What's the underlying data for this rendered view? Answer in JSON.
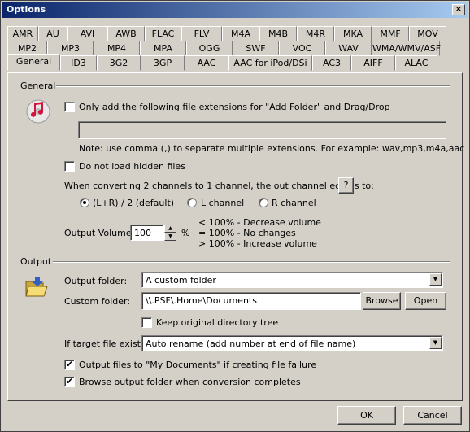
{
  "window": {
    "title": "Options",
    "close_glyph": "×"
  },
  "tabs_row1": [
    "AMR",
    "AU",
    "AVI",
    "AWB",
    "FLAC",
    "FLV",
    "M4A",
    "M4B",
    "M4R",
    "MKA",
    "MMF",
    "MOV"
  ],
  "tabs_row2": [
    "MP2",
    "MP3",
    "MP4",
    "MPA",
    "OGG",
    "SWF",
    "VOC",
    "WAV",
    "WMA/WMV/ASF"
  ],
  "tabs_row3": [
    "General",
    "ID3",
    "3G2",
    "3GP",
    "AAC",
    "AAC for iPod/DSi",
    "AC3",
    "AIFF",
    "ALAC"
  ],
  "active_tab": "General",
  "general": {
    "section_label": "General",
    "only_add_ext_label": "Only add the following file extensions for \"Add Folder\" and Drag/Drop",
    "only_add_ext_checked": false,
    "extensions_value": "",
    "note": "Note: use comma (,) to separate multiple extensions. For example: wav,mp3,m4a,aac",
    "no_hidden_label": "Do not load hidden files",
    "no_hidden_checked": false,
    "channel_prompt": "When converting 2 channels to 1 channel, the out channel equals to:",
    "help_label": "?",
    "radio_lr": "(L+R) / 2 (default)",
    "radio_l": "L channel",
    "radio_r": "R channel",
    "selected_channel": "lr",
    "volume_label": "Output Volume:",
    "volume_value": "100",
    "volume_unit": "%",
    "volume_notes": [
      "< 100% - Decrease volume",
      "= 100% - No changes",
      "> 100% - Increase volume"
    ]
  },
  "output": {
    "section_label": "Output",
    "folder_label": "Output folder:",
    "folder_value": "A custom folder",
    "custom_label": "Custom folder:",
    "custom_value": "\\\\.PSF\\.Home\\Documents",
    "browse_label": "Browse",
    "open_label": "Open",
    "keep_tree_label": "Keep original directory tree",
    "keep_tree_checked": false,
    "exists_label": "If target file exists",
    "exists_value": "Auto rename (add number at end of file name)",
    "my_docs_label": "Output files to \"My Documents\" if creating file failure",
    "my_docs_checked": true,
    "browse_done_label": "Browse output folder when conversion completes",
    "browse_done_checked": true
  },
  "buttons": {
    "ok": "OK",
    "cancel": "Cancel"
  },
  "icons": {
    "music": "music-note-icon",
    "folder": "open-folder-icon"
  },
  "colors": {
    "titlebar": "#0a246a",
    "face": "#d4d0c8"
  }
}
